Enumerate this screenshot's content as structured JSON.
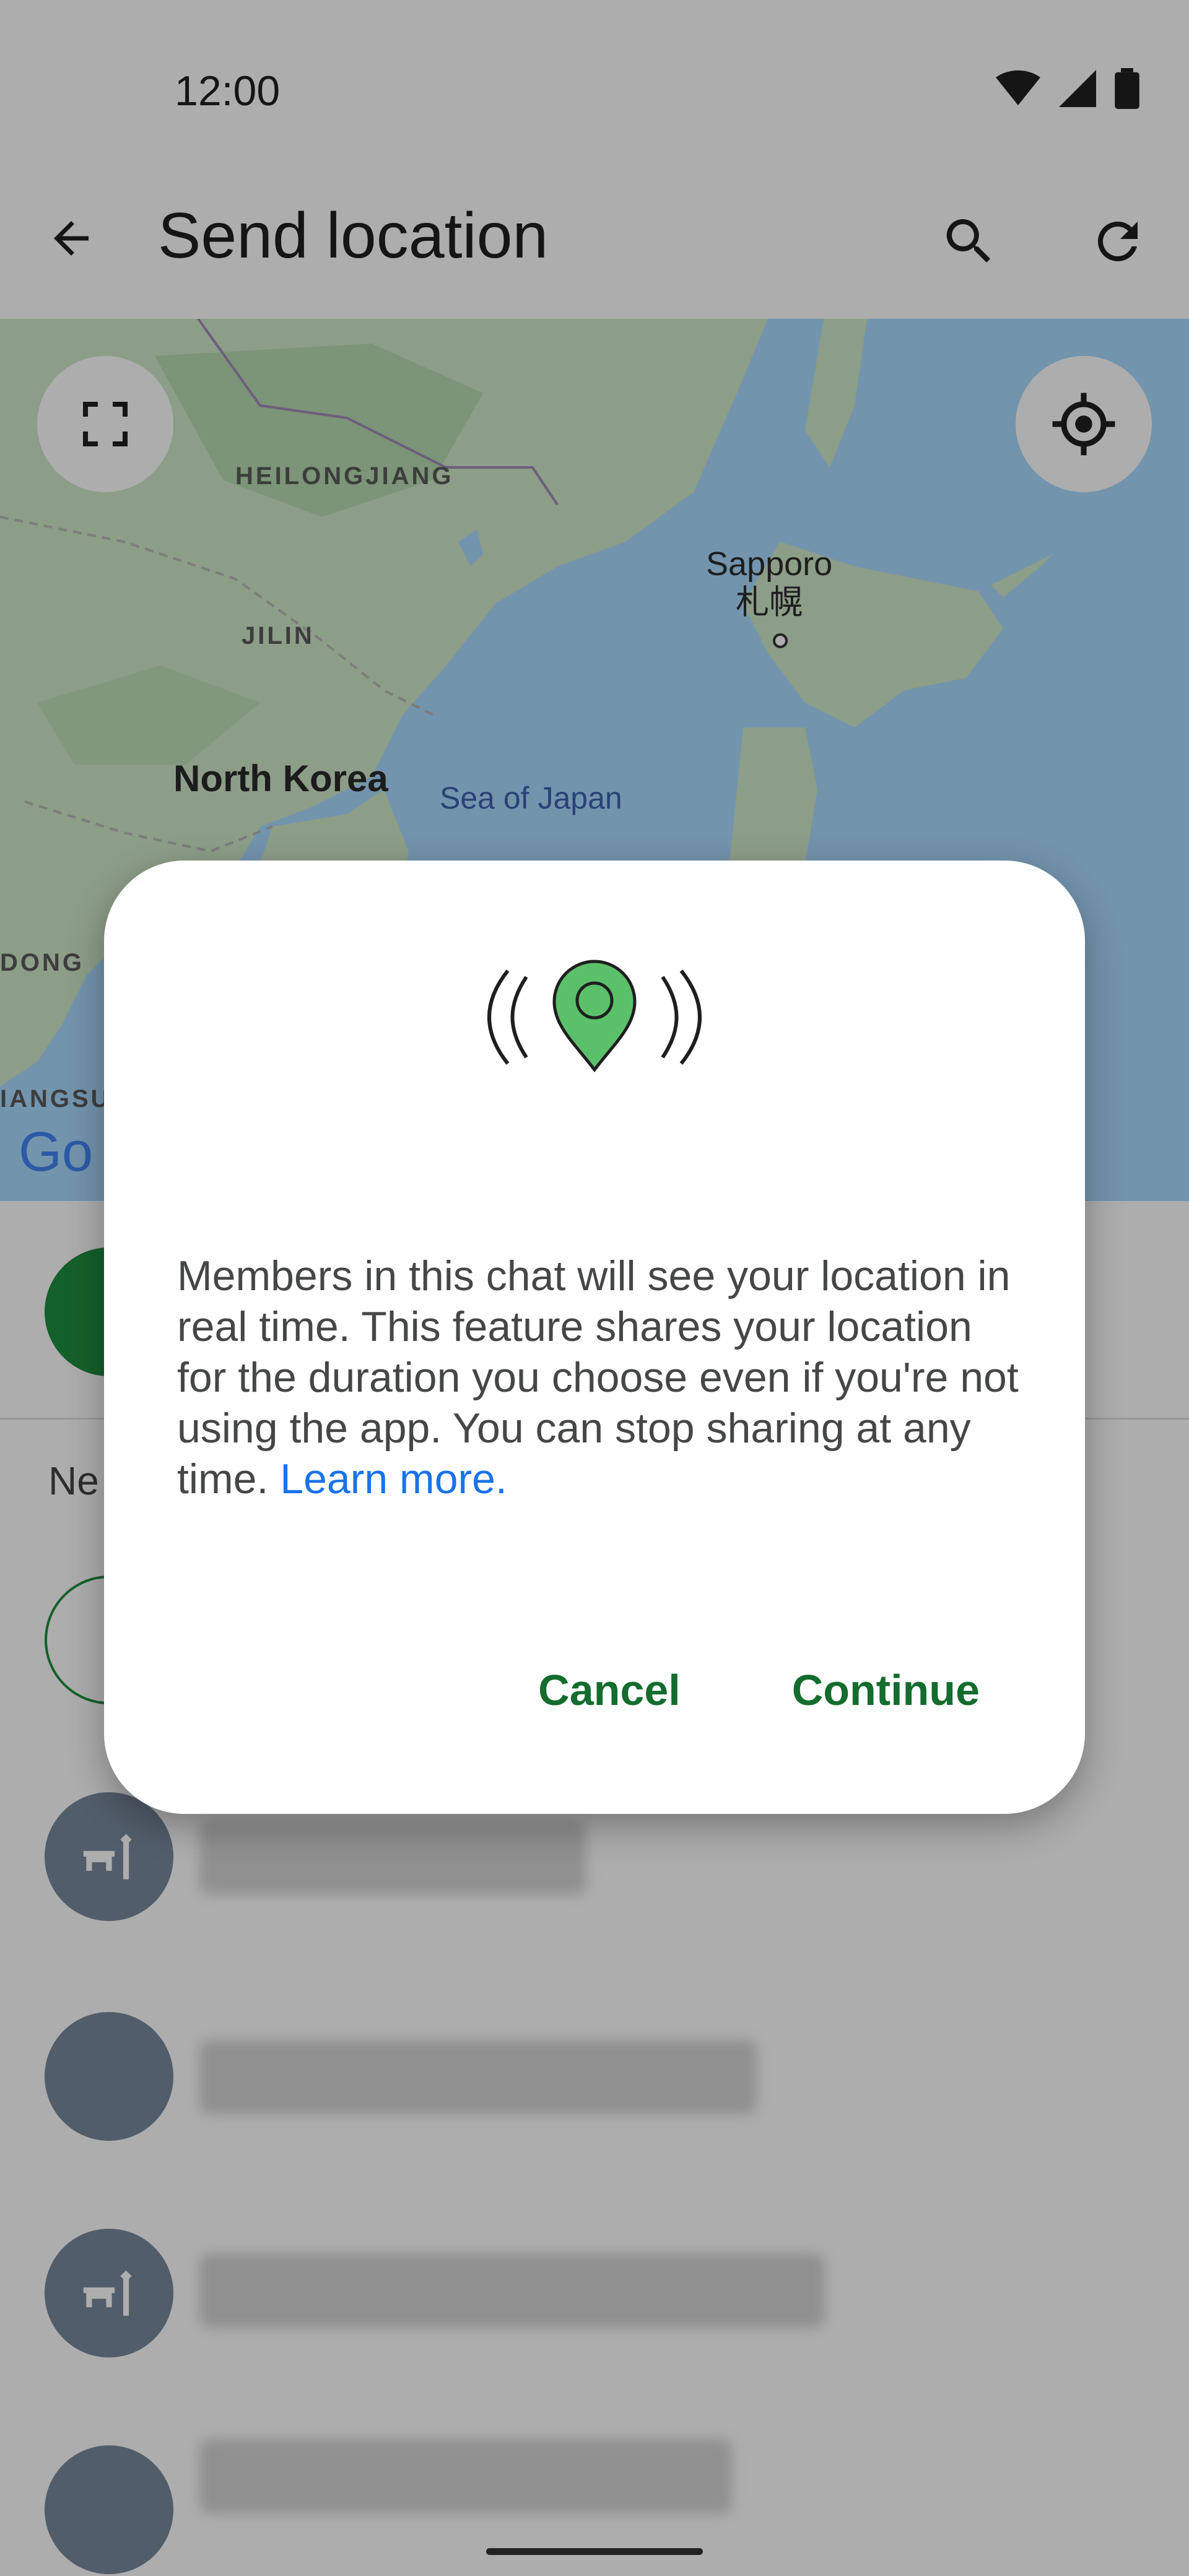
{
  "status_bar": {
    "time": "12:00",
    "icons": [
      "wifi-icon",
      "cellular-signal-icon",
      "battery-icon"
    ]
  },
  "app_bar": {
    "title": "Send location",
    "icons": [
      "back-arrow-icon",
      "search-icon",
      "refresh-icon"
    ]
  },
  "map": {
    "labels": {
      "heilongjiang": "HEILONGJIANG",
      "jilin": "JILIN",
      "north_korea": "North Korea",
      "sea_of_japan": "Sea of Japan",
      "sapporo": "Sapporo",
      "sapporo_local": "札幌",
      "dong": "DONG",
      "jiangsu": "IANGSU",
      "google": "Go"
    },
    "colors": {
      "water": "#aadaff",
      "land": "#cfe8c9"
    }
  },
  "list": {
    "nearby_header": "Ne"
  },
  "dialog": {
    "body": "Members in this chat will see your location in real time. This feature shares your location for the duration you choose even if you're not using the app. You can stop sharing at any time. ",
    "learn_more": "Learn more",
    "period": ".",
    "cancel_label": "Cancel",
    "continue_label": "Continue",
    "accent_color": "#146c2e",
    "pin_color": "#5bc06a"
  }
}
